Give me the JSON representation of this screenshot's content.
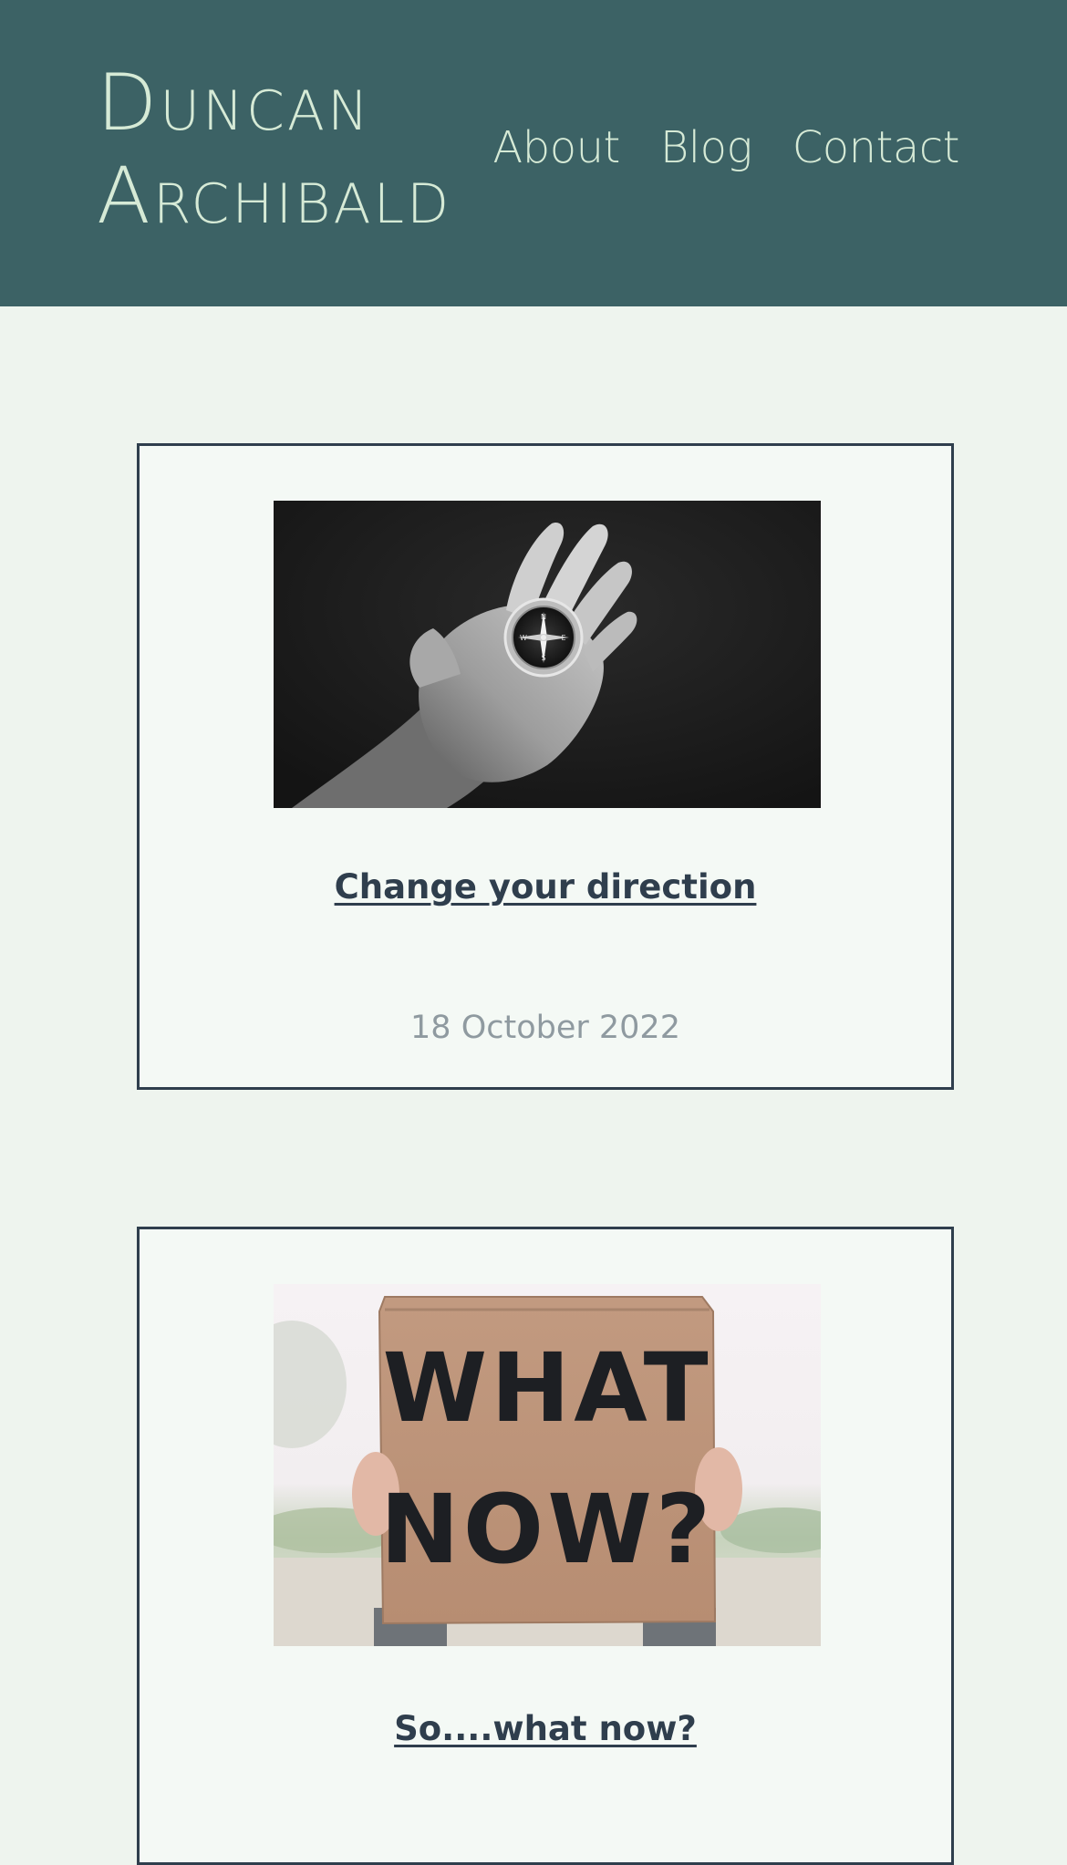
{
  "header": {
    "site_title_line1": "Duncan",
    "site_title_line2": "Archibald",
    "nav": {
      "about": "About",
      "blog": "Blog",
      "contact": "Contact"
    }
  },
  "posts": [
    {
      "title": "Change your direction",
      "date": "18 October 2022",
      "image_alt": "compass-in-hand-photo"
    },
    {
      "title": "So....what now?",
      "image_alt": "what-now-sign-photo",
      "sign_line1": "WHAT",
      "sign_line2": "NOW?"
    }
  ],
  "colors": {
    "header_bg": "#3c6265",
    "page_bg": "#eef4ee",
    "card_bg": "#f4f9f5",
    "card_border": "#2f3e4d",
    "title_text": "#2f3e4d",
    "date_text": "#8f9aa0",
    "header_text": "#d6ead6"
  }
}
